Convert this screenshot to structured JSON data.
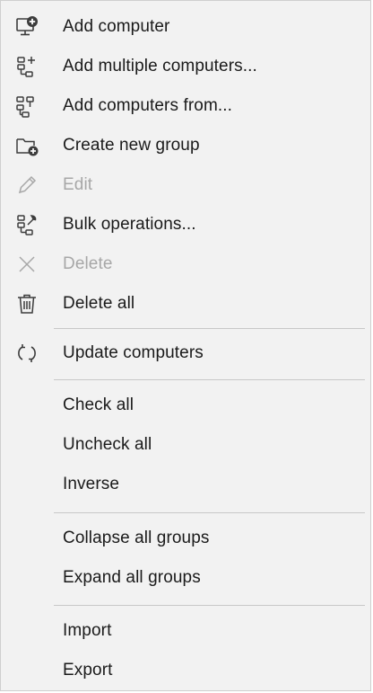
{
  "menu": {
    "items": [
      {
        "label": "Add computer",
        "icon": "add-computer-icon",
        "enabled": true
      },
      {
        "label": "Add multiple computers...",
        "icon": "add-multiple-computers-icon",
        "enabled": true
      },
      {
        "label": "Add computers from...",
        "icon": "add-computers-from-icon",
        "enabled": true
      },
      {
        "label": "Create new group",
        "icon": "create-group-icon",
        "enabled": true
      },
      {
        "label": "Edit",
        "icon": "pencil-icon",
        "enabled": false
      },
      {
        "label": "Bulk operations...",
        "icon": "bulk-operations-icon",
        "enabled": true
      },
      {
        "label": "Delete",
        "icon": "close-icon",
        "enabled": false
      },
      {
        "label": "Delete all",
        "icon": "trash-icon",
        "enabled": true
      },
      {
        "label": "Update computers",
        "icon": "refresh-icon",
        "enabled": true
      },
      {
        "label": "Check all",
        "enabled": true
      },
      {
        "label": "Uncheck all",
        "enabled": true
      },
      {
        "label": "Inverse",
        "enabled": true
      },
      {
        "label": "Collapse all groups",
        "enabled": true
      },
      {
        "label": "Expand all groups",
        "enabled": true
      },
      {
        "label": "Import",
        "enabled": true
      },
      {
        "label": "Export",
        "enabled": true
      }
    ]
  },
  "colors": {
    "background": "#f2f2f2",
    "text": "#1a1a1a",
    "disabled_text": "#a7a7a7",
    "separator": "#c8c8c8",
    "icon": "#3c3c3c"
  }
}
